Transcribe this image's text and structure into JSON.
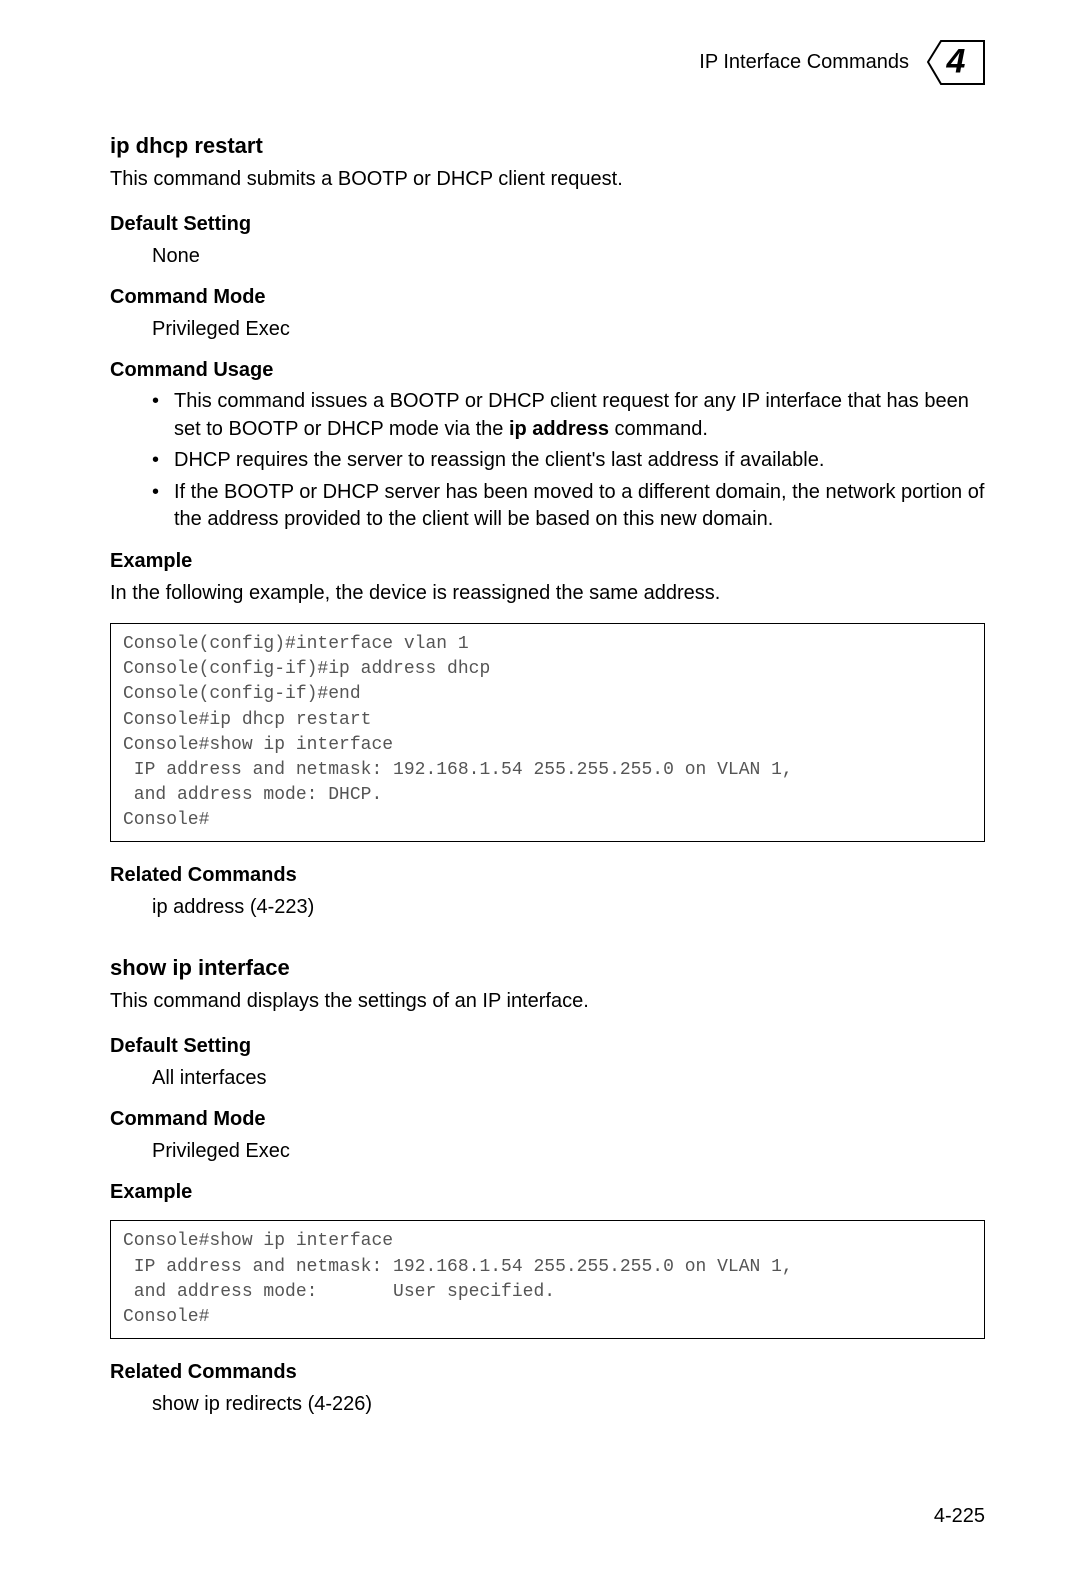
{
  "header": {
    "title": "IP Interface Commands",
    "chapter_number": "4"
  },
  "sections": [
    {
      "title": "ip dhcp restart",
      "desc": "This command submits a BOOTP or DHCP client request.",
      "default_setting_label": "Default Setting",
      "default_setting_value": "None",
      "command_mode_label": "Command Mode",
      "command_mode_value": "Privileged Exec",
      "command_usage_label": "Command Usage",
      "usage_items": [
        {
          "pre": "This command issues a BOOTP or DHCP client request for any IP interface that has been set to BOOTP or DHCP mode via the ",
          "bold": "ip address",
          "post": " command."
        },
        {
          "pre": "DHCP requires the server to reassign the client's last address if available.",
          "bold": "",
          "post": ""
        },
        {
          "pre": "If the BOOTP or DHCP server has been moved to a different domain, the network portion of the address provided to the client will be based on this new domain.",
          "bold": "",
          "post": ""
        }
      ],
      "example_label": "Example",
      "example_intro": "In the following example, the device is reassigned the same address.",
      "code": "Console(config)#interface vlan 1\nConsole(config-if)#ip address dhcp\nConsole(config-if)#end\nConsole#ip dhcp restart\nConsole#show ip interface\n IP address and netmask: 192.168.1.54 255.255.255.0 on VLAN 1,\n and address mode: DHCP.\nConsole#",
      "related_label": "Related Commands",
      "related_value": "ip address (4-223)"
    },
    {
      "title": "show ip interface",
      "desc": "This command displays the settings of an IP interface.",
      "default_setting_label": "Default Setting",
      "default_setting_value": "All interfaces",
      "command_mode_label": "Command Mode",
      "command_mode_value": "Privileged Exec",
      "example_label": "Example",
      "code": "Console#show ip interface\n IP address and netmask: 192.168.1.54 255.255.255.0 on VLAN 1,\n and address mode:       User specified.\nConsole#",
      "related_label": "Related Commands",
      "related_value": "show ip redirects (4-226)"
    }
  ],
  "page_number": "4-225"
}
